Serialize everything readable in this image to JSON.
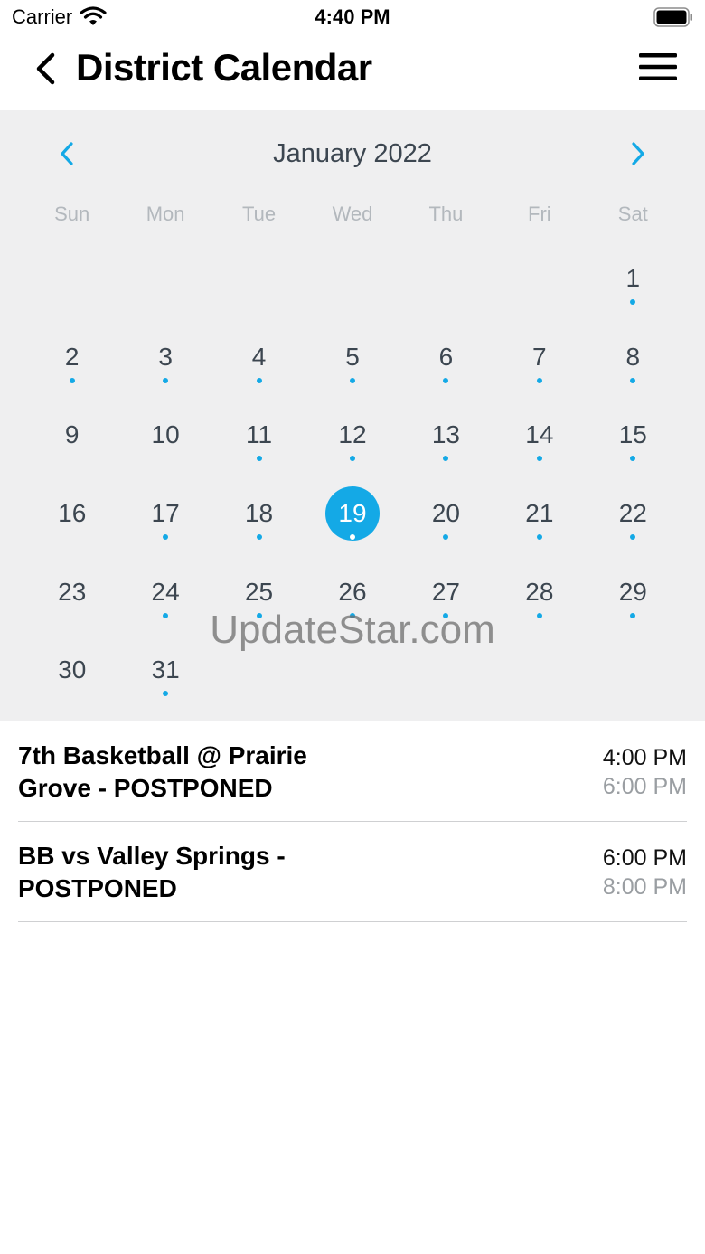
{
  "status_bar": {
    "carrier": "Carrier",
    "time": "4:40 PM"
  },
  "nav": {
    "title": "District Calendar",
    "back_icon": "chevron-left-icon",
    "menu_icon": "hamburger-menu-icon"
  },
  "calendar": {
    "month_label": "January 2022",
    "weekdays": [
      "Sun",
      "Mon",
      "Tue",
      "Wed",
      "Thu",
      "Fri",
      "Sat"
    ],
    "leading_blank_days": 6,
    "days": [
      {
        "label": "1",
        "has_event": true,
        "selected": false
      },
      {
        "label": "2",
        "has_event": true,
        "selected": false
      },
      {
        "label": "3",
        "has_event": true,
        "selected": false
      },
      {
        "label": "4",
        "has_event": true,
        "selected": false
      },
      {
        "label": "5",
        "has_event": true,
        "selected": false
      },
      {
        "label": "6",
        "has_event": true,
        "selected": false
      },
      {
        "label": "7",
        "has_event": true,
        "selected": false
      },
      {
        "label": "8",
        "has_event": true,
        "selected": false
      },
      {
        "label": "9",
        "has_event": false,
        "selected": false
      },
      {
        "label": "10",
        "has_event": false,
        "selected": false
      },
      {
        "label": "11",
        "has_event": true,
        "selected": false
      },
      {
        "label": "12",
        "has_event": true,
        "selected": false
      },
      {
        "label": "13",
        "has_event": true,
        "selected": false
      },
      {
        "label": "14",
        "has_event": true,
        "selected": false
      },
      {
        "label": "15",
        "has_event": true,
        "selected": false
      },
      {
        "label": "16",
        "has_event": false,
        "selected": false
      },
      {
        "label": "17",
        "has_event": true,
        "selected": false
      },
      {
        "label": "18",
        "has_event": true,
        "selected": false
      },
      {
        "label": "19",
        "has_event": true,
        "selected": true
      },
      {
        "label": "20",
        "has_event": true,
        "selected": false
      },
      {
        "label": "21",
        "has_event": true,
        "selected": false
      },
      {
        "label": "22",
        "has_event": true,
        "selected": false
      },
      {
        "label": "23",
        "has_event": false,
        "selected": false
      },
      {
        "label": "24",
        "has_event": true,
        "selected": false
      },
      {
        "label": "25",
        "has_event": true,
        "selected": false
      },
      {
        "label": "26",
        "has_event": true,
        "selected": false
      },
      {
        "label": "27",
        "has_event": true,
        "selected": false
      },
      {
        "label": "28",
        "has_event": true,
        "selected": false
      },
      {
        "label": "29",
        "has_event": true,
        "selected": false
      },
      {
        "label": "30",
        "has_event": false,
        "selected": false
      },
      {
        "label": "31",
        "has_event": true,
        "selected": false
      }
    ]
  },
  "watermark": "UpdateStar.com",
  "events": [
    {
      "title": "7th Basketball @ Prairie Grove - POSTPONED",
      "start": "4:00 PM",
      "end": "6:00 PM"
    },
    {
      "title": "BB vs Valley Springs - POSTPONED",
      "start": "6:00 PM",
      "end": "8:00 PM"
    }
  ],
  "colors": {
    "accent": "#14a9e6",
    "calendar_bg": "#efeff0",
    "day_text": "#3c4650",
    "weekday_text": "#b3b8bd"
  }
}
